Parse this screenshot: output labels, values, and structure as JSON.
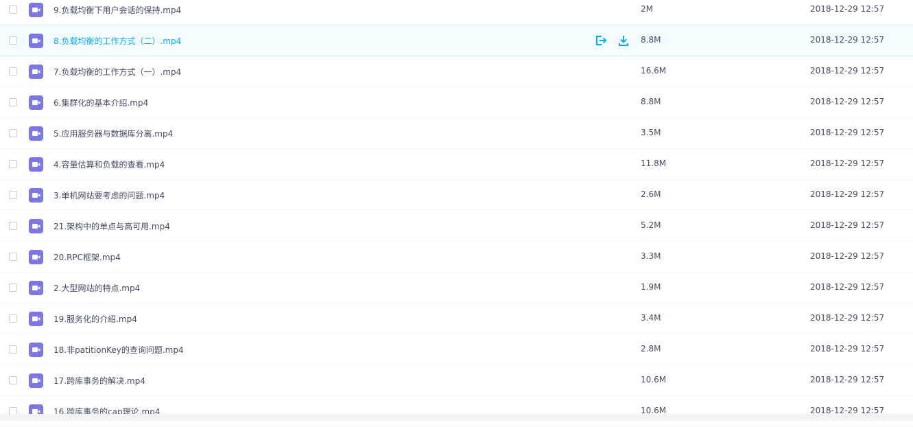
{
  "colors": {
    "accent": "#09aaff",
    "video_icon": "#7b78e5",
    "text": "#424e67",
    "hover_row": "#f4fbff"
  },
  "actions": {
    "share_icon": "share-icon",
    "download_icon": "download-icon"
  },
  "files": [
    {
      "name": "9.负载均衡下用户会话的保持.mp4",
      "size": "2M",
      "date": "2018-12-29 12:57"
    },
    {
      "name": "8.负载均衡的工作方式（二）.mp4",
      "size": "8.8M",
      "date": "2018-12-29 12:57",
      "hover": true
    },
    {
      "name": "7.负载均衡的工作方式（一）.mp4",
      "size": "16.6M",
      "date": "2018-12-29 12:57"
    },
    {
      "name": "6.集群化的基本介绍.mp4",
      "size": "8.8M",
      "date": "2018-12-29 12:57"
    },
    {
      "name": "5.应用服务器与数据库分离.mp4",
      "size": "3.5M",
      "date": "2018-12-29 12:57"
    },
    {
      "name": "4.容量估算和负载的查看.mp4",
      "size": "11.8M",
      "date": "2018-12-29 12:57"
    },
    {
      "name": "3.单机网站要考虑的问题.mp4",
      "size": "2.6M",
      "date": "2018-12-29 12:57"
    },
    {
      "name": "21.架构中的单点与高可用.mp4",
      "size": "5.2M",
      "date": "2018-12-29 12:57"
    },
    {
      "name": "20.RPC框架.mp4",
      "size": "3.3M",
      "date": "2018-12-29 12:57"
    },
    {
      "name": "2.大型网站的特点.mp4",
      "size": "1.9M",
      "date": "2018-12-29 12:57"
    },
    {
      "name": "19.服务化的介绍.mp4",
      "size": "3.4M",
      "date": "2018-12-29 12:57"
    },
    {
      "name": "18.非patitionKey的查询问题.mp4",
      "size": "2.8M",
      "date": "2018-12-29 12:57"
    },
    {
      "name": "17.跨库事务的解决.mp4",
      "size": "10.6M",
      "date": "2018-12-29 12:57"
    },
    {
      "name": "16.跨库事务的cap理论.mp4",
      "size": "10.6M",
      "date": "2018-12-29 12:57"
    }
  ]
}
